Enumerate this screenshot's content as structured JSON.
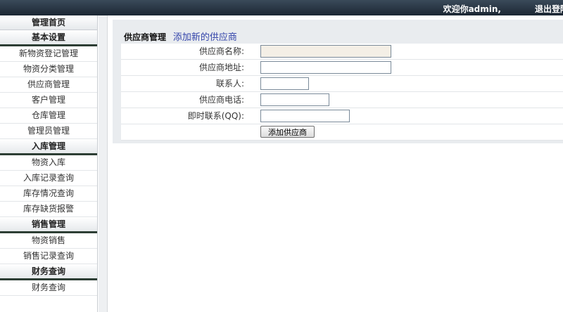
{
  "header": {
    "welcome": "欢迎你admin,",
    "logout": "退出登陆"
  },
  "sidebar": {
    "home": "管理首页",
    "groups": [
      {
        "title": "基本设置",
        "items": [
          "新物资登记管理",
          "物资分类管理",
          "供应商管理",
          "客户管理",
          "仓库管理",
          "管理员管理"
        ]
      },
      {
        "title": "入库管理",
        "items": [
          "物资入库",
          "入库记录查询",
          "库存情况查询",
          "库存缺货报警"
        ]
      },
      {
        "title": "销售管理",
        "items": [
          "物资销售",
          "销售记录查询"
        ]
      },
      {
        "title": "财务查询",
        "items": [
          "财务查询"
        ]
      }
    ]
  },
  "main": {
    "section": "供应商管理",
    "action": "添加新的供应商",
    "fields": [
      {
        "label": "供应商名称:",
        "value": ""
      },
      {
        "label": "供应商地址:",
        "value": ""
      },
      {
        "label": "联系人:",
        "value": ""
      },
      {
        "label": "供应商电话:",
        "value": ""
      },
      {
        "label": "即时联系(QQ):",
        "value": ""
      }
    ],
    "submit": "添加供应商"
  },
  "colors": {
    "topbar": "#1c2733",
    "panel": "#e9ecef",
    "link": "#3344aa",
    "focused_input": "#f4efe6"
  }
}
